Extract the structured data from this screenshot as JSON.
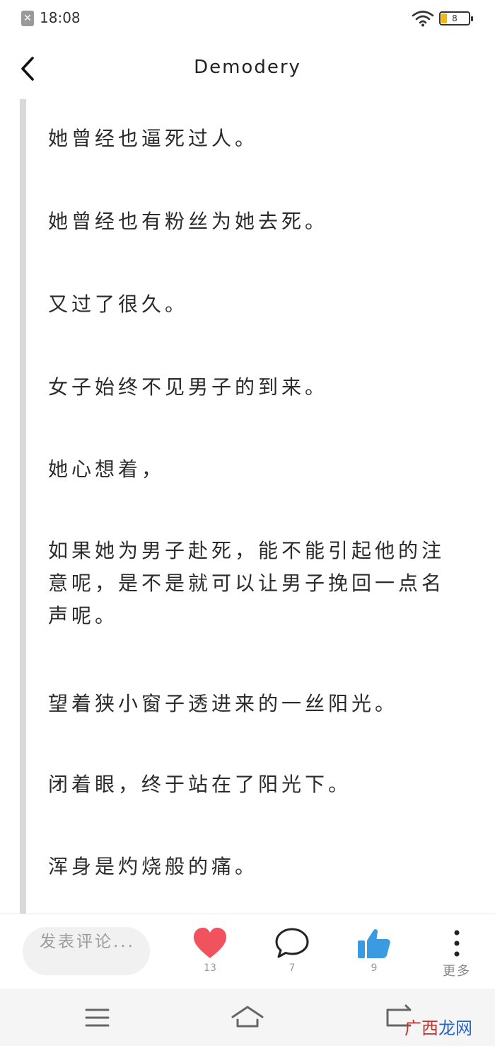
{
  "status_bar": {
    "notification_icon": "close-box-icon",
    "time": "18:08",
    "battery_level": "8",
    "battery_color": "#f2b90c"
  },
  "header": {
    "back_icon": "chevron-left-icon",
    "title": "Demodery"
  },
  "article": {
    "paragraphs": [
      "她曾经也逼死过人。",
      "她曾经也有粉丝为她去死。",
      "又过了很久。",
      "女子始终不见男子的到来。",
      "她心想着，",
      "如果她为男子赴死，能不能引起他的注意呢，是不是就可以让男子挽回一点名声呢。",
      "望着狭小窗子透进来的一丝阳光。",
      "闭着眼，终于站在了阳光下。",
      "浑身是灼烧般的痛。"
    ]
  },
  "action_bar": {
    "comment_placeholder": "发表评论...",
    "like_count": "13",
    "comment_count": "7",
    "thumbs_count": "9",
    "more_label": "更多",
    "heart_color": "#f0525e",
    "thumb_color": "#3a9be3"
  },
  "nav_bar": {
    "menu_icon": "menu-icon",
    "home_icon": "home-icon",
    "back_icon": "return-icon"
  },
  "watermark": {
    "red_text": "广西",
    "blue_text": "龙网"
  }
}
